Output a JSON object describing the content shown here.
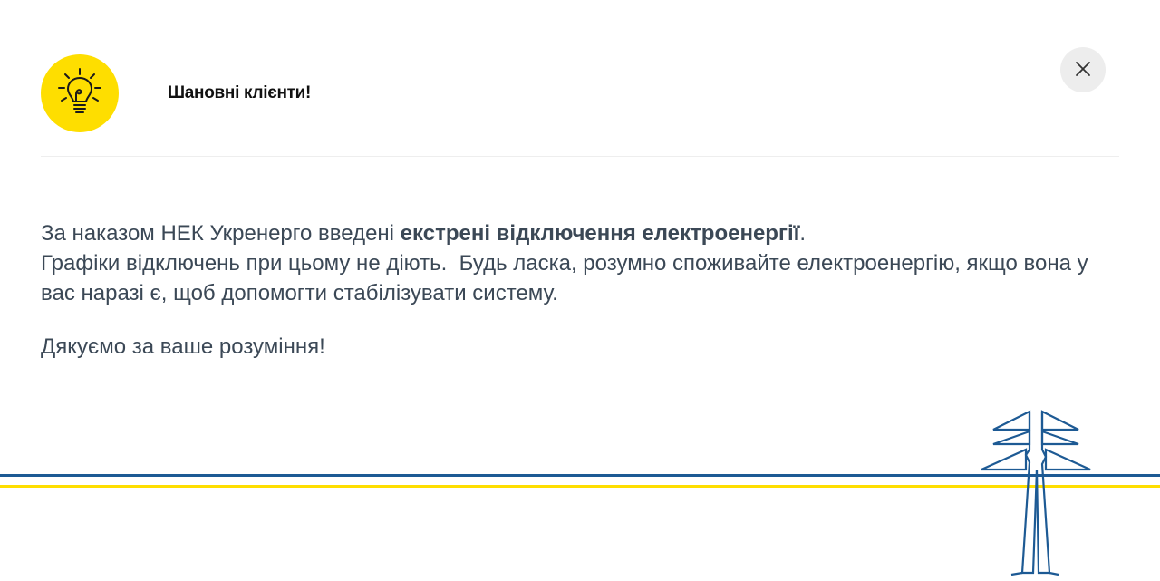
{
  "header": {
    "title": "Шановні клієнти!",
    "icon": "lightbulb-icon",
    "badge_color": "#FEDE00"
  },
  "close_button": {
    "icon": "close-icon",
    "label": "×"
  },
  "message": {
    "line1_prefix": "За наказом НЕК Укренерго введені ",
    "line1_bold": "екстрені відключення електроенергії",
    "line1_suffix": ".",
    "line2": "Графіки відключень при цьому не діють.  Будь ласка, розумно споживайте електроенергію, якщо вона у вас наразі є, щоб допомогти стабілізувати систему.",
    "thanks": "Дякуємо за ваше розуміння!"
  },
  "decor": {
    "pylon_icon": "power-pylon-icon",
    "blue": "#1d5a94",
    "yellow": "#FEDE00"
  }
}
